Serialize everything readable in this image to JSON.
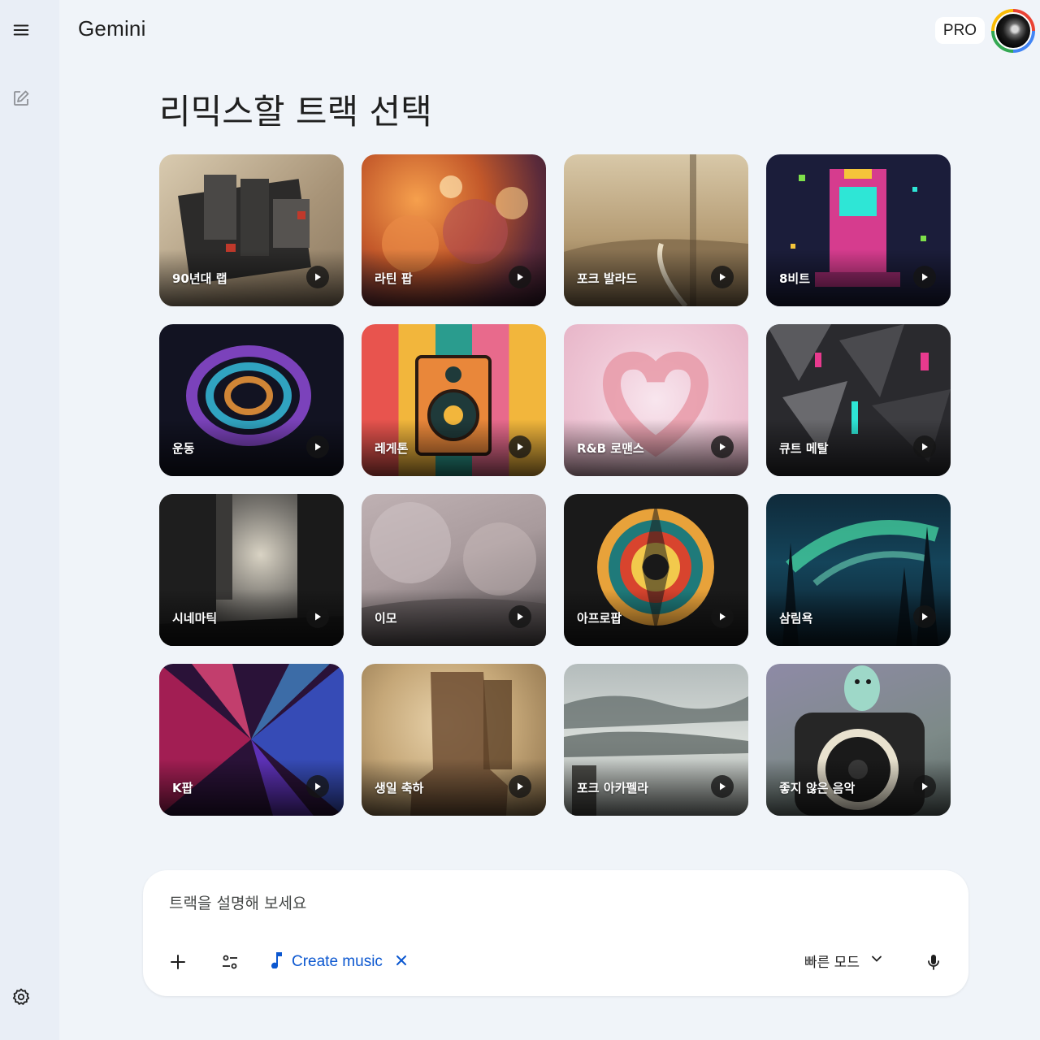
{
  "colors": {
    "accent": "#0b57d0",
    "background": "#f0f4f9",
    "sidebar": "#e9eef6"
  },
  "sidebar": {
    "menu_icon": "menu-icon",
    "new_chat_icon": "edit-icon",
    "settings_icon": "settings-icon"
  },
  "header": {
    "title": "Gemini",
    "badge": "PRO"
  },
  "page": {
    "title": "리믹스할 트랙 선택"
  },
  "tracks": [
    {
      "label": "90년대 랩"
    },
    {
      "label": "라틴 팝"
    },
    {
      "label": "포크 발라드"
    },
    {
      "label": "8비트"
    },
    {
      "label": "운동"
    },
    {
      "label": "레게톤"
    },
    {
      "label": "R&B 로맨스"
    },
    {
      "label": "큐트 메탈"
    },
    {
      "label": "시네마틱"
    },
    {
      "label": "이모"
    },
    {
      "label": "아프로팝"
    },
    {
      "label": "삼림욕"
    },
    {
      "label": "K팝"
    },
    {
      "label": "생일 축하"
    },
    {
      "label": "포크 아카펠라"
    },
    {
      "label": "좋지 않은 음악"
    }
  ],
  "composer": {
    "placeholder": "트랙을 설명해 보세요",
    "tool_chip": "Create music",
    "mode": "빠른 모드"
  }
}
